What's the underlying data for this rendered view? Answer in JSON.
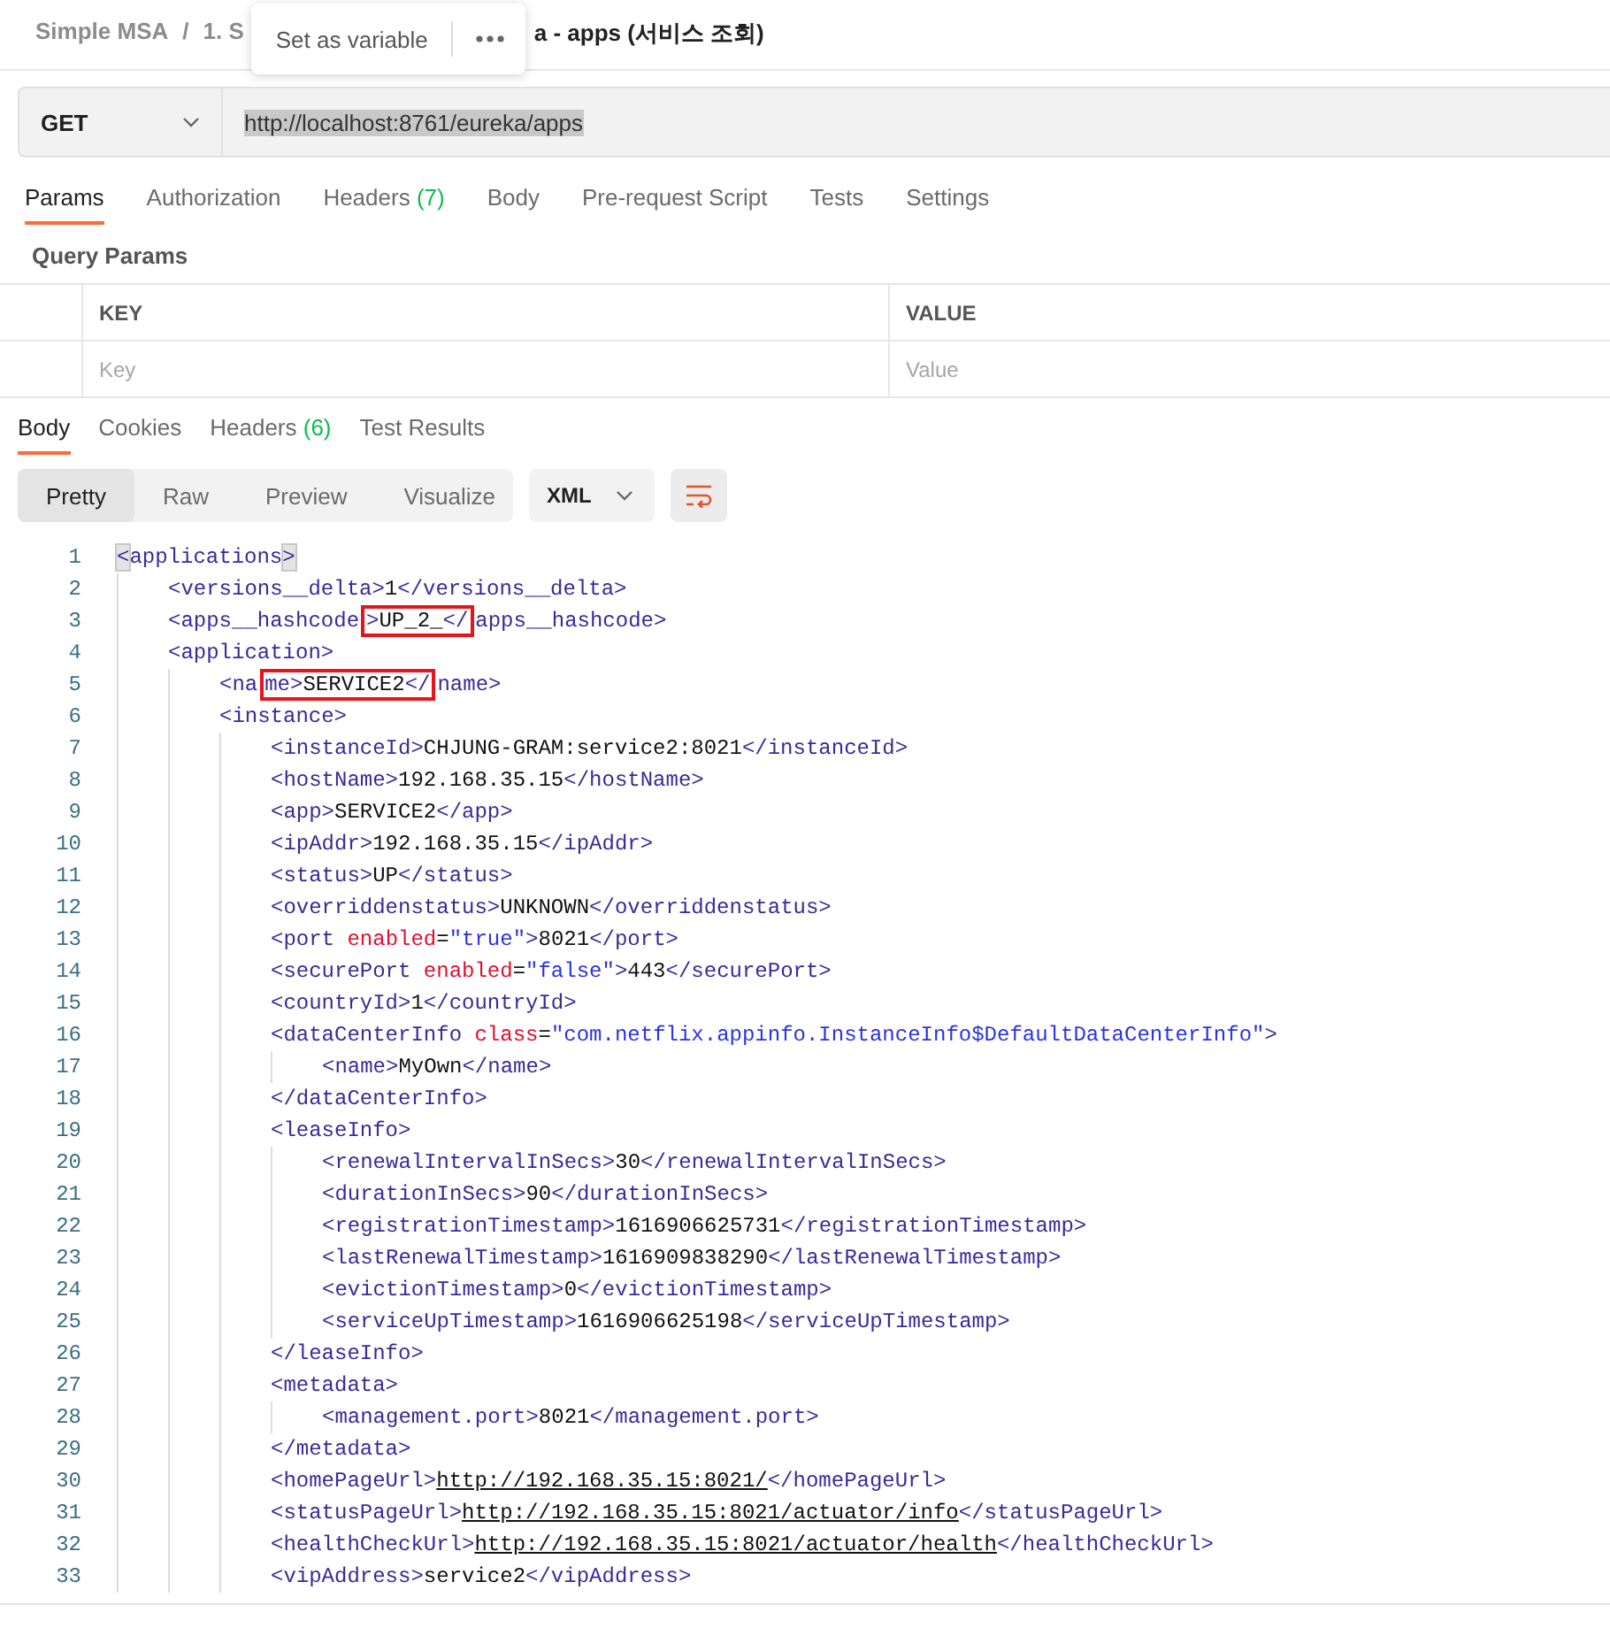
{
  "breadcrumb": {
    "items": [
      "Simple MSA",
      "1. S"
    ],
    "separator": "/",
    "title": "a - apps (서비스 조회)"
  },
  "popup": {
    "action": "Set as variable"
  },
  "request": {
    "method": "GET",
    "url": {
      "value": "http://localhost:8761/eureka/apps",
      "selected": true
    }
  },
  "request_tabs": [
    {
      "label": "Params",
      "selected": true
    },
    {
      "label": "Authorization",
      "selected": false
    },
    {
      "label": "Headers",
      "count": "(7)",
      "selected": false
    },
    {
      "label": "Body",
      "selected": false
    },
    {
      "label": "Pre-request Script",
      "selected": false
    },
    {
      "label": "Tests",
      "selected": false
    },
    {
      "label": "Settings",
      "selected": false
    }
  ],
  "query_params": {
    "title": "Query Params",
    "columns": [
      "KEY",
      "VALUE"
    ],
    "placeholders": [
      "Key",
      "Value"
    ]
  },
  "response_tabs": [
    {
      "label": "Body",
      "selected": true
    },
    {
      "label": "Cookies",
      "selected": false
    },
    {
      "label": "Headers",
      "count": "(6)",
      "selected": false
    },
    {
      "label": "Test Results",
      "selected": false
    }
  ],
  "view_modes": [
    {
      "label": "Pretty",
      "selected": true
    },
    {
      "label": "Raw",
      "selected": false
    },
    {
      "label": "Preview",
      "selected": false
    },
    {
      "label": "Visualize",
      "selected": false
    }
  ],
  "format": "XML",
  "code_lines": [
    {
      "number": "1",
      "tokens": [
        {
          "kind": "tag",
          "text": "<",
          "matched": true
        },
        {
          "kind": "tag",
          "text": "applications"
        },
        {
          "kind": "tag",
          "text": ">",
          "matched": true
        }
      ],
      "children": [
        {
          "number": "2",
          "tokens": [
            {
              "kind": "tag",
              "text": "<versions__delta>"
            },
            {
              "kind": "text",
              "text": "1"
            },
            {
              "kind": "tag",
              "text": "</versions__delta>"
            }
          ]
        },
        {
          "number": "3",
          "tokens": [
            {
              "kind": "tag",
              "text": "<apps__hashcode"
            },
            {
              "kind": "box",
              "tokens": [
                {
                  "kind": "tag",
                  "text": ">"
                },
                {
                  "kind": "text",
                  "text": "UP_2_"
                },
                {
                  "kind": "tag",
                  "text": "</"
                }
              ]
            },
            {
              "kind": "tag",
              "text": "apps__hashcode>"
            }
          ]
        },
        {
          "number": "4",
          "tokens": [
            {
              "kind": "tag",
              "text": "<application>"
            }
          ],
          "children": [
            {
              "number": "5",
              "tokens": [
                {
                  "kind": "tag",
                  "text": "<na"
                },
                {
                  "kind": "box",
                  "tokens": [
                    {
                      "kind": "tag",
                      "text": "me>"
                    },
                    {
                      "kind": "text",
                      "text": "SERVICE2"
                    },
                    {
                      "kind": "tag",
                      "text": "</"
                    }
                  ]
                },
                {
                  "kind": "tag",
                  "text": "name>"
                }
              ]
            },
            {
              "number": "6",
              "tokens": [
                {
                  "kind": "tag",
                  "text": "<instance>"
                }
              ],
              "children": [
                {
                  "number": "7",
                  "tokens": [
                    {
                      "kind": "tag",
                      "text": "<instanceId>"
                    },
                    {
                      "kind": "text",
                      "text": "CHJUNG-GRAM:service2:8021"
                    },
                    {
                      "kind": "tag",
                      "text": "</instanceId>"
                    }
                  ]
                },
                {
                  "number": "8",
                  "tokens": [
                    {
                      "kind": "tag",
                      "text": "<hostName>"
                    },
                    {
                      "kind": "text",
                      "text": "192.168.35.15"
                    },
                    {
                      "kind": "tag",
                      "text": "</hostName>"
                    }
                  ]
                },
                {
                  "number": "9",
                  "tokens": [
                    {
                      "kind": "tag",
                      "text": "<app>"
                    },
                    {
                      "kind": "text",
                      "text": "SERVICE2"
                    },
                    {
                      "kind": "tag",
                      "text": "</app>"
                    }
                  ]
                },
                {
                  "number": "10",
                  "tokens": [
                    {
                      "kind": "tag",
                      "text": "<ipAddr>"
                    },
                    {
                      "kind": "text",
                      "text": "192.168.35.15"
                    },
                    {
                      "kind": "tag",
                      "text": "</ipAddr>"
                    }
                  ]
                },
                {
                  "number": "11",
                  "tokens": [
                    {
                      "kind": "tag",
                      "text": "<status>"
                    },
                    {
                      "kind": "text",
                      "text": "UP"
                    },
                    {
                      "kind": "tag",
                      "text": "</status>"
                    }
                  ]
                },
                {
                  "number": "12",
                  "tokens": [
                    {
                      "kind": "tag",
                      "text": "<overriddenstatus>"
                    },
                    {
                      "kind": "text",
                      "text": "UNKNOWN"
                    },
                    {
                      "kind": "tag",
                      "text": "</overriddenstatus>"
                    }
                  ]
                },
                {
                  "number": "13",
                  "tokens": [
                    {
                      "kind": "tag",
                      "text": "<port"
                    },
                    {
                      "kind": "attr",
                      "text": " enabled"
                    },
                    {
                      "kind": "text",
                      "text": "="
                    },
                    {
                      "kind": "value",
                      "text": "\"true\""
                    },
                    {
                      "kind": "tag",
                      "text": ">"
                    },
                    {
                      "kind": "text",
                      "text": "8021"
                    },
                    {
                      "kind": "tag",
                      "text": "</port>"
                    }
                  ]
                },
                {
                  "number": "14",
                  "tokens": [
                    {
                      "kind": "tag",
                      "text": "<securePort"
                    },
                    {
                      "kind": "attr",
                      "text": " enabled"
                    },
                    {
                      "kind": "text",
                      "text": "="
                    },
                    {
                      "kind": "value",
                      "text": "\"false\""
                    },
                    {
                      "kind": "tag",
                      "text": ">"
                    },
                    {
                      "kind": "text",
                      "text": "443"
                    },
                    {
                      "kind": "tag",
                      "text": "</securePort>"
                    }
                  ]
                },
                {
                  "number": "15",
                  "tokens": [
                    {
                      "kind": "tag",
                      "text": "<countryId>"
                    },
                    {
                      "kind": "text",
                      "text": "1"
                    },
                    {
                      "kind": "tag",
                      "text": "</countryId>"
                    }
                  ]
                },
                {
                  "number": "16",
                  "tokens": [
                    {
                      "kind": "tag",
                      "text": "<dataCenterInfo"
                    },
                    {
                      "kind": "attr",
                      "text": " class"
                    },
                    {
                      "kind": "text",
                      "text": "="
                    },
                    {
                      "kind": "value",
                      "text": "\"com.netflix.appinfo.InstanceInfo$DefaultDataCenterInfo\""
                    },
                    {
                      "kind": "tag",
                      "text": ">"
                    }
                  ],
                  "children": [
                    {
                      "number": "17",
                      "tokens": [
                        {
                          "kind": "tag",
                          "text": "<name>"
                        },
                        {
                          "kind": "text",
                          "text": "MyOwn"
                        },
                        {
                          "kind": "tag",
                          "text": "</name>"
                        }
                      ]
                    }
                  ]
                },
                {
                  "number": "18",
                  "tokens": [
                    {
                      "kind": "tag",
                      "text": "</dataCenterInfo>"
                    }
                  ]
                },
                {
                  "number": "19",
                  "tokens": [
                    {
                      "kind": "tag",
                      "text": "<leaseInfo>"
                    }
                  ],
                  "children": [
                    {
                      "number": "20",
                      "tokens": [
                        {
                          "kind": "tag",
                          "text": "<renewalIntervalInSecs>"
                        },
                        {
                          "kind": "text",
                          "text": "30"
                        },
                        {
                          "kind": "tag",
                          "text": "</renewalIntervalInSecs>"
                        }
                      ]
                    },
                    {
                      "number": "21",
                      "tokens": [
                        {
                          "kind": "tag",
                          "text": "<durationInSecs>"
                        },
                        {
                          "kind": "text",
                          "text": "90"
                        },
                        {
                          "kind": "tag",
                          "text": "</durationInSecs>"
                        }
                      ]
                    },
                    {
                      "number": "22",
                      "tokens": [
                        {
                          "kind": "tag",
                          "text": "<registrationTimestamp>"
                        },
                        {
                          "kind": "text",
                          "text": "1616906625731"
                        },
                        {
                          "kind": "tag",
                          "text": "</registrationTimestamp>"
                        }
                      ]
                    },
                    {
                      "number": "23",
                      "tokens": [
                        {
                          "kind": "tag",
                          "text": "<lastRenewalTimestamp>"
                        },
                        {
                          "kind": "text",
                          "text": "1616909838290"
                        },
                        {
                          "kind": "tag",
                          "text": "</lastRenewalTimestamp>"
                        }
                      ]
                    },
                    {
                      "number": "24",
                      "tokens": [
                        {
                          "kind": "tag",
                          "text": "<evictionTimestamp>"
                        },
                        {
                          "kind": "text",
                          "text": "0"
                        },
                        {
                          "kind": "tag",
                          "text": "</evictionTimestamp>"
                        }
                      ]
                    },
                    {
                      "number": "25",
                      "tokens": [
                        {
                          "kind": "tag",
                          "text": "<serviceUpTimestamp>"
                        },
                        {
                          "kind": "text",
                          "text": "1616906625198"
                        },
                        {
                          "kind": "tag",
                          "text": "</serviceUpTimestamp>"
                        }
                      ]
                    }
                  ]
                },
                {
                  "number": "26",
                  "tokens": [
                    {
                      "kind": "tag",
                      "text": "</leaseInfo>"
                    }
                  ]
                },
                {
                  "number": "27",
                  "tokens": [
                    {
                      "kind": "tag",
                      "text": "<metadata>"
                    }
                  ],
                  "children": [
                    {
                      "number": "28",
                      "tokens": [
                        {
                          "kind": "tag",
                          "text": "<management.port>"
                        },
                        {
                          "kind": "text",
                          "text": "8021"
                        },
                        {
                          "kind": "tag",
                          "text": "</management.port>"
                        }
                      ]
                    }
                  ]
                },
                {
                  "number": "29",
                  "tokens": [
                    {
                      "kind": "tag",
                      "text": "</metadata>"
                    }
                  ]
                },
                {
                  "number": "30",
                  "tokens": [
                    {
                      "kind": "tag",
                      "text": "<homePageUrl>"
                    },
                    {
                      "kind": "link",
                      "text": "http://192.168.35.15:8021/"
                    },
                    {
                      "kind": "tag",
                      "text": "</homePageUrl>"
                    }
                  ]
                },
                {
                  "number": "31",
                  "tokens": [
                    {
                      "kind": "tag",
                      "text": "<statusPageUrl>"
                    },
                    {
                      "kind": "link",
                      "text": "http://192.168.35.15:8021/actuator/info"
                    },
                    {
                      "kind": "tag",
                      "text": "</statusPageUrl>"
                    }
                  ]
                },
                {
                  "number": "32",
                  "tokens": [
                    {
                      "kind": "tag",
                      "text": "<healthCheckUrl>"
                    },
                    {
                      "kind": "link",
                      "text": "http://192.168.35.15:8021/actuator/health"
                    },
                    {
                      "kind": "tag",
                      "text": "</healthCheckUrl>"
                    }
                  ]
                },
                {
                  "number": "33",
                  "tokens": [
                    {
                      "kind": "tag",
                      "text": "<vipAddress>"
                    },
                    {
                      "kind": "text",
                      "text": "service2"
                    },
                    {
                      "kind": "tag",
                      "text": "</vipAddress>"
                    }
                  ]
                }
              ]
            }
          ]
        }
      ]
    }
  ]
}
